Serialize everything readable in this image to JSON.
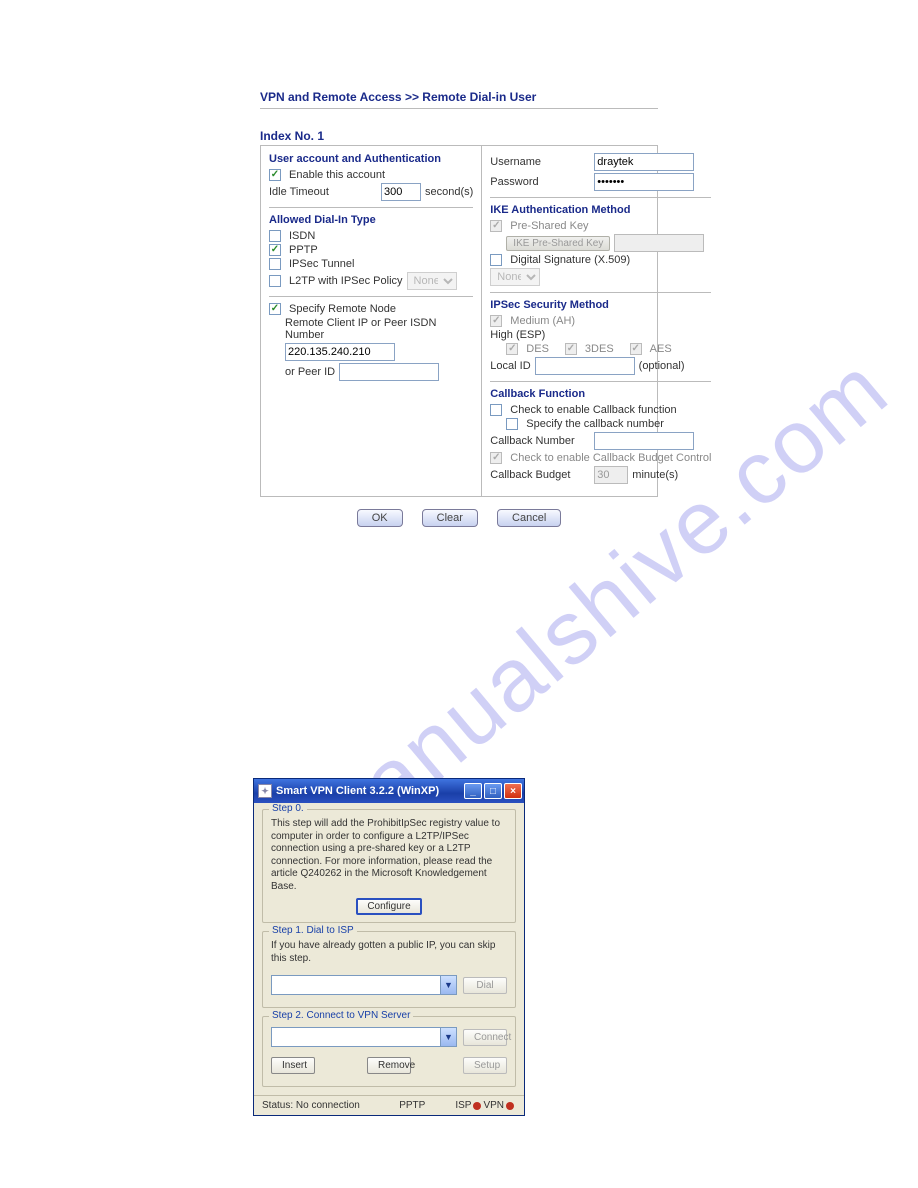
{
  "breadcrumb": "VPN and Remote Access >> Remote Dial-in User",
  "index": "Index No. 1",
  "userAuth": {
    "title": "User account and Authentication",
    "enable": "Enable this account",
    "idleTimeout": "Idle Timeout",
    "idleValue": "300",
    "idleUnit": "second(s)"
  },
  "dialIn": {
    "title": "Allowed Dial-In Type",
    "isdn": "ISDN",
    "pptp": "PPTP",
    "ipsec": "IPSec Tunnel",
    "l2tp": "L2TP with IPSec Policy",
    "l2tpPolicy": "None",
    "specify": "Specify Remote Node",
    "remoteLabel": "Remote Client IP or Peer ISDN Number",
    "remoteValue": "220.135.240.210",
    "peerId": "or Peer ID"
  },
  "creds": {
    "userLabel": "Username",
    "userValue": "draytek",
    "passLabel": "Password",
    "passValue": "•••••••"
  },
  "ike": {
    "title": "IKE Authentication Method",
    "psk": "Pre-Shared Key",
    "pskBtn": "IKE Pre-Shared Key",
    "digSig": "Digital Signature (X.509)",
    "digSigSelect": "None"
  },
  "ipsecSec": {
    "title": "IPSec Security Method",
    "medium": "Medium (AH)",
    "high": "High (ESP)",
    "des": "DES",
    "tdes": "3DES",
    "aes": "AES",
    "localId": "Local ID",
    "optional": "(optional)"
  },
  "callback": {
    "title": "Callback Function",
    "enable": "Check to enable Callback function",
    "specify": "Specify the callback number",
    "numLabel": "Callback Number",
    "budgetEnable": "Check to enable Callback Budget Control",
    "budgetLabel": "Callback Budget",
    "budgetVal": "30",
    "budgetUnit": "minute(s)"
  },
  "buttons": {
    "ok": "OK",
    "clear": "Clear",
    "cancel": "Cancel"
  },
  "watermark": "manualshive.com",
  "xp": {
    "title": "Smart VPN Client  3.2.2 (WinXP)",
    "step0": {
      "legend": "Step 0.",
      "text": "This step will add the ProhibitIpSec registry value to computer in order to configure a L2TP/IPSec connection using a pre-shared key or a L2TP connection. For more information, please read the article Q240262 in the Microsoft Knowledgement Base.",
      "btn": "Configure"
    },
    "step1": {
      "legend": "Step 1. Dial to ISP",
      "text": "If you have already gotten a public IP, you can skip this step.",
      "btn": "Dial"
    },
    "step2": {
      "legend": "Step 2. Connect to VPN Server",
      "connect": "Connect",
      "insert": "Insert",
      "remove": "Remove",
      "setup": "Setup"
    },
    "status": {
      "status": "Status: No connection",
      "proto": "PPTP",
      "isp": "ISP",
      "vpn": "VPN"
    }
  }
}
